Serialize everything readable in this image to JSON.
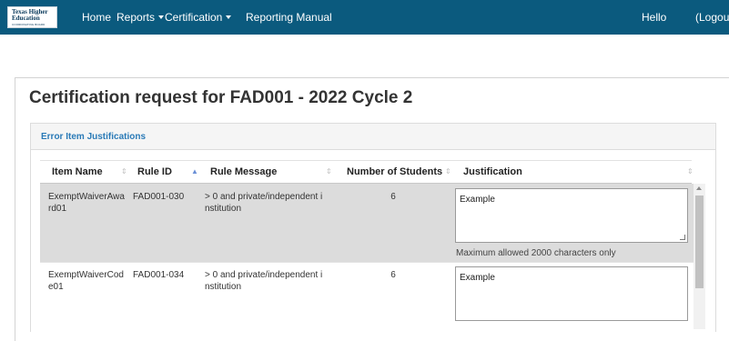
{
  "navbar": {
    "logo": {
      "line1": "Texas Higher",
      "line2": "Education",
      "line3": "COORDINATING BOARD"
    },
    "items": [
      {
        "label": "Home",
        "dropdown": false
      },
      {
        "label": "Reports",
        "dropdown": true
      },
      {
        "label": "Certification",
        "dropdown": true
      },
      {
        "label": "Reporting Manual",
        "dropdown": false
      }
    ],
    "greeting": "Hello",
    "logout": "(Logout"
  },
  "page": {
    "title": "Certification request for FAD001 - 2022 Cycle 2"
  },
  "panel": {
    "title": "Error Item Justifications"
  },
  "table": {
    "columns": [
      {
        "label": "Item Name",
        "sort": "none"
      },
      {
        "label": "Rule ID",
        "sort": "ascending"
      },
      {
        "label": "Rule Message",
        "sort": "none"
      },
      {
        "label": "Number of Students",
        "sort": "none"
      },
      {
        "label": "Justification",
        "sort": "none"
      }
    ],
    "rows": [
      {
        "item_name_l1": "ExemptWaiverAwa",
        "item_name_l2": "rd01",
        "rule_id": "FAD001-030",
        "message_l1": "> 0 and private/independent i",
        "message_l2": "nstitution",
        "students": "6",
        "justification": "Example",
        "hint": "Maximum allowed 2000 characters only",
        "highlighted": true
      },
      {
        "item_name_l1": "ExemptWaiverCod",
        "item_name_l2": "e01",
        "rule_id": "FAD001-034",
        "message_l1": "> 0 and private/independent i",
        "message_l2": "nstitution",
        "students": "6",
        "justification": "Example",
        "highlighted": false
      }
    ]
  },
  "colors": {
    "navbar_bg": "#0b5a7e",
    "panel_title": "#2a7ab7",
    "highlight_row": "#dcdcdc"
  }
}
